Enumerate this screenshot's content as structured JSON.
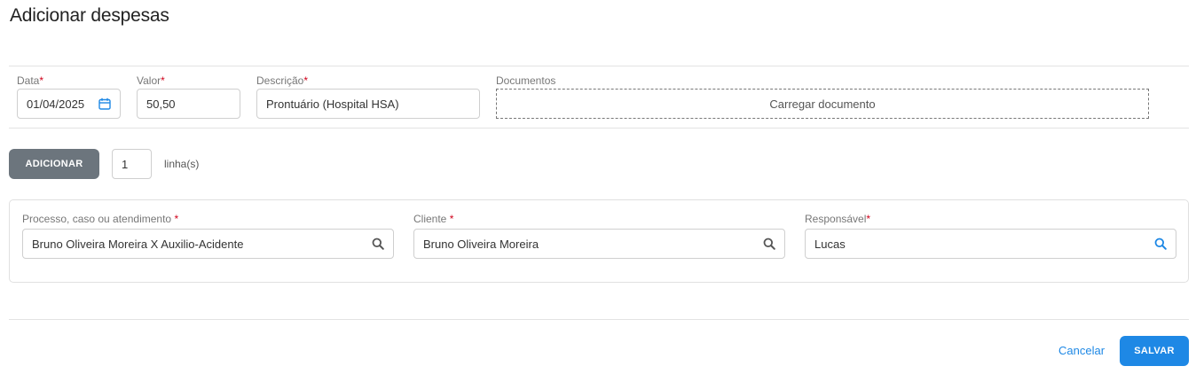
{
  "page": {
    "title": "Adicionar despesas"
  },
  "form": {
    "data": {
      "label": "Data",
      "required_mark": "*",
      "value": "01/04/2025",
      "icon": "calendar-icon"
    },
    "valor": {
      "label": "Valor",
      "required_mark": "*",
      "value": "50,50"
    },
    "descricao": {
      "label": "Descrição",
      "required_mark": "*",
      "value": "Prontuário (Hospital HSA)"
    },
    "documentos": {
      "label": "Documentos",
      "upload_label": "Carregar documento"
    }
  },
  "add_row": {
    "button_label": "ADICIONAR",
    "lines_value": "1",
    "lines_label": "linha(s)"
  },
  "details": {
    "processo": {
      "label": "Processo, caso ou atendimento ",
      "required_mark": "*",
      "value": "Bruno Oliveira Moreira X Auxilio-Acidente",
      "icon": "search-icon",
      "icon_color": "#555555"
    },
    "cliente": {
      "label": "Cliente ",
      "required_mark": "*",
      "value": "Bruno Oliveira Moreira",
      "icon": "search-icon",
      "icon_color": "#555555"
    },
    "responsavel": {
      "label": "Responsável",
      "required_mark": "*",
      "value": "Lucas",
      "icon": "search-icon",
      "icon_color": "#1e88e5"
    }
  },
  "footer": {
    "cancel_label": "Cancelar",
    "save_label": "SALVAR"
  },
  "colors": {
    "primary": "#1e88e5",
    "secondary_button": "#6c757d",
    "required": "#d0021b"
  }
}
